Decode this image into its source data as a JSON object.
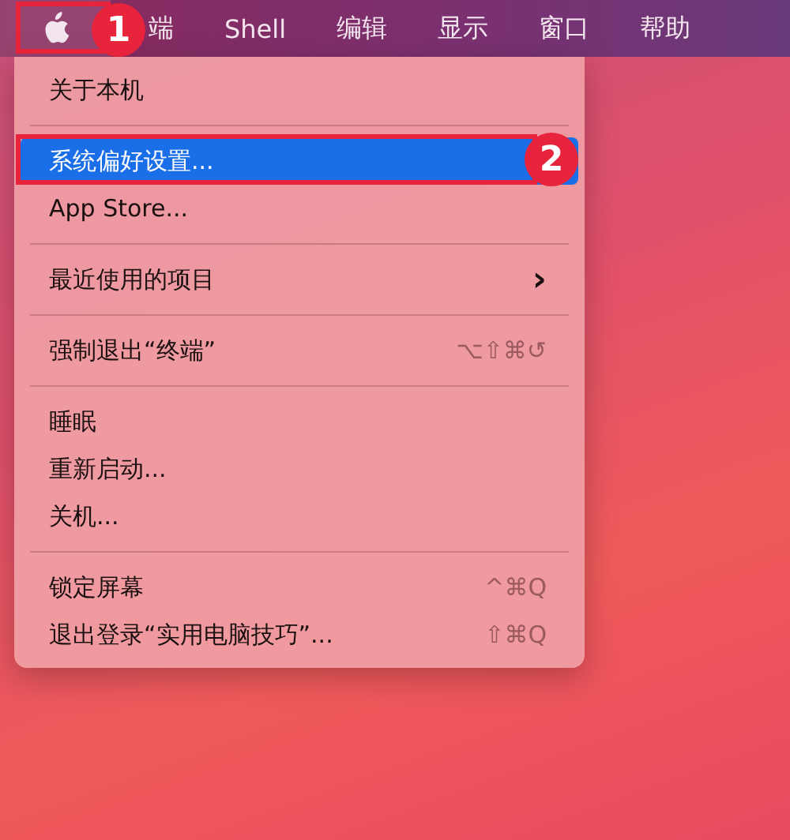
{
  "menu_bar": {
    "items": [
      {
        "label": "端"
      },
      {
        "label": "Shell"
      },
      {
        "label": "编辑"
      },
      {
        "label": "显示"
      },
      {
        "label": "窗口"
      },
      {
        "label": "帮助"
      }
    ]
  },
  "apple_menu": {
    "items": [
      {
        "kind": "item",
        "label": "关于本机",
        "selected": false
      },
      {
        "kind": "separator"
      },
      {
        "kind": "item",
        "label": "系统偏好设置...",
        "selected": true
      },
      {
        "kind": "item",
        "label": "App Store...",
        "selected": false
      },
      {
        "kind": "separator"
      },
      {
        "kind": "submenu",
        "label": "最近使用的项目",
        "selected": false,
        "arrow": "›"
      },
      {
        "kind": "separator"
      },
      {
        "kind": "item",
        "label": "强制退出“终端”",
        "selected": false,
        "shortcut": "⌥⇧⌘↺"
      },
      {
        "kind": "separator"
      },
      {
        "kind": "item",
        "label": "睡眠",
        "selected": false
      },
      {
        "kind": "item",
        "label": "重新启动...",
        "selected": false
      },
      {
        "kind": "item",
        "label": "关机...",
        "selected": false
      },
      {
        "kind": "separator"
      },
      {
        "kind": "item",
        "label": "锁定屏幕",
        "selected": false,
        "shortcut": "^⌘Q"
      },
      {
        "kind": "item",
        "label": "退出登录“实用电脑技巧”...",
        "selected": false,
        "shortcut": "⇧⌘Q"
      }
    ]
  },
  "annotations": [
    {
      "number": "1"
    },
    {
      "number": "2"
    }
  ]
}
